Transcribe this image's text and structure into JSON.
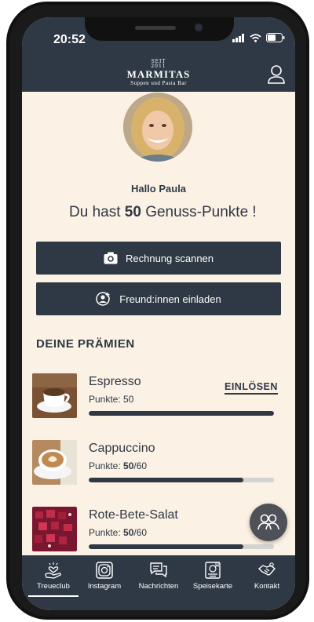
{
  "status_bar": {
    "time": "20:52"
  },
  "brand": {
    "seit": "SEIT",
    "year": "2011",
    "name": "MARMITAS",
    "tagline": "Suppen und Pasta Bar"
  },
  "greeting": "Hallo Paula",
  "points": {
    "prefix": "Du hast",
    "value": "50",
    "suffix": "Genuss-Punkte !"
  },
  "actions": {
    "scan_label": "Rechnung scannen",
    "invite_label": "Freund:innen einladen"
  },
  "rewards_section": {
    "title": "DEINE PRÄMIEN"
  },
  "rewards": [
    {
      "name": "Espresso",
      "points_label": "Punkte:",
      "points_text": "50",
      "progress": 1.0,
      "redeem_label": "EINLÖSEN"
    },
    {
      "name": "Cappuccino",
      "points_label": "Punkte:",
      "points_current": "50",
      "points_total": "/60",
      "progress": 0.8333
    },
    {
      "name": "Rote-Bete-Salat",
      "points_label": "Punkte:",
      "points_current": "50",
      "points_total": "/60",
      "progress": 0.8333
    }
  ],
  "tabs": [
    {
      "label": "Treueclub",
      "icon": "hand-heart-icon",
      "active": true
    },
    {
      "label": "Instagram",
      "icon": "instagram-icon",
      "active": false
    },
    {
      "label": "Nachrichten",
      "icon": "chat-bubbles-icon",
      "active": false
    },
    {
      "label": "Speisekarte",
      "icon": "menu-book-icon",
      "active": false
    },
    {
      "label": "Kontakt",
      "icon": "handshake-icon",
      "active": false
    }
  ],
  "colors": {
    "primary": "#2e3945",
    "background": "#fbf1e4",
    "progress_track": "#d3d3d3",
    "fab": "#4e5158"
  }
}
